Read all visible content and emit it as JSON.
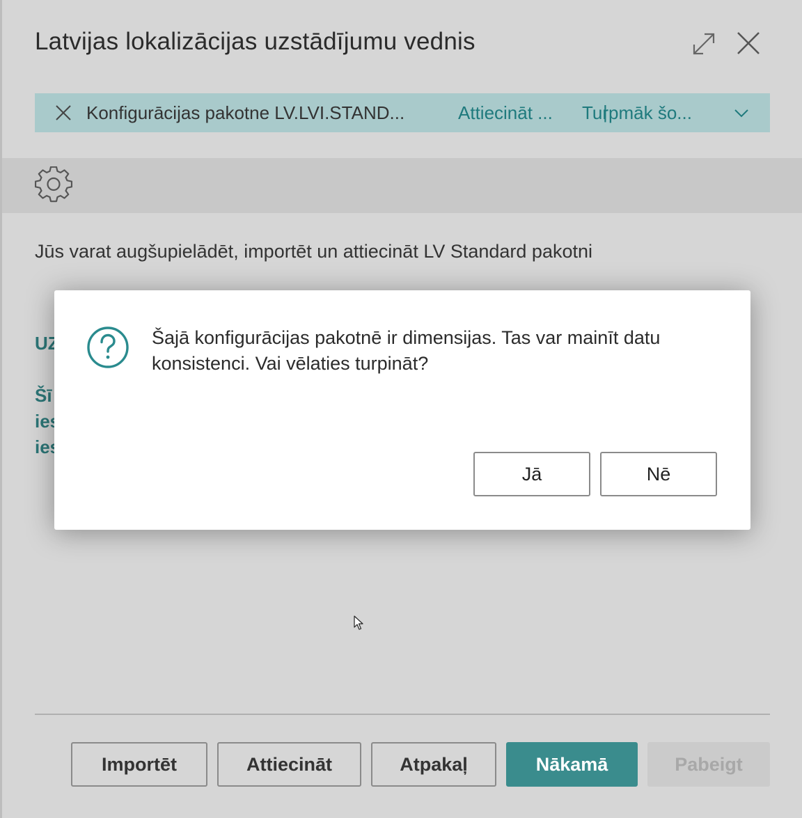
{
  "window": {
    "title": "Latvijas lokalizācijas uzstādījumu vednis"
  },
  "notification": {
    "text": "Konfigurācijas pakotne LV.LVI.STAND...",
    "action_apply": "Attiecināt ...",
    "separator": "|",
    "action_more": "Turpmāk šo..."
  },
  "page": {
    "description": "Jūs varat augšupielādēt, importēt un attiecināt LV Standard pakotni",
    "heading_partial": "UZ",
    "para_partial_1": "Šī",
    "para_partial_2": "ies",
    "para_partial_3": "ies"
  },
  "footer": {
    "import_label": "Importēt",
    "apply_label": "Attiecināt",
    "back_label": "Atpakaļ",
    "next_label": "Nākamā",
    "finish_label": "Pabeigt"
  },
  "dialog": {
    "message": "Šajā konfigurācijas pakotnē ir dimensijas. Tas var mainīt datu konsistenci. Vai vēlaties turpināt?",
    "yes_label": "Jā",
    "no_label": "Nē"
  },
  "colors": {
    "accent": "#3a8c8d",
    "notification_bg": "#a9cacb",
    "link_text": "#1f7a7d"
  },
  "icons": {
    "expand": "expand-icon",
    "close": "close-icon",
    "settings": "gear-icon",
    "question": "question-icon",
    "chevron": "chevron-down-icon"
  }
}
